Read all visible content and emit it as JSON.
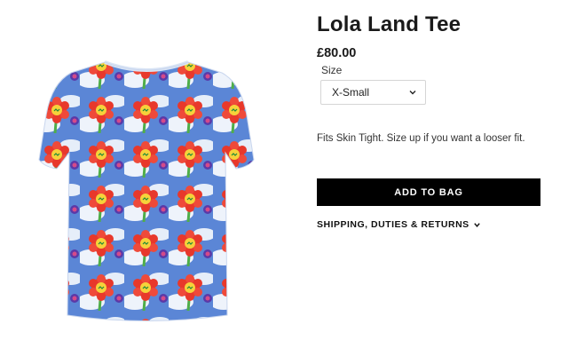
{
  "product": {
    "title": "Lola Land Tee",
    "price": "£80.00",
    "size_label": "Size",
    "size_selected": "X-Small",
    "fit_note": "Fits Skin Tight. Size up if you want a looser fit.",
    "add_to_bag": "ADD TO BAG",
    "shipping_label": "SHIPPING, DUTIES & RETURNS"
  },
  "icons": {
    "select_chevron": "chevron-down-icon",
    "shipping_chevron": "chevron-down-icon"
  },
  "colors": {
    "button_bg": "#000000",
    "button_text": "#ffffff",
    "shirt_sky": "#4f7fd0"
  }
}
